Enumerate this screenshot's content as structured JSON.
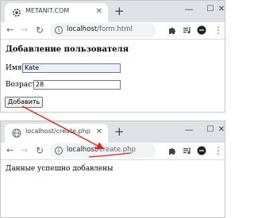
{
  "window1": {
    "tab_title": "METANIT.COM",
    "new_tab": "+",
    "url_host": "localhost",
    "url_path": "/form.html",
    "page": {
      "heading": "Добавление пользователя",
      "name_label": "Имя:",
      "name_value": "Kate",
      "age_label": "Возраст:",
      "age_value": "28",
      "submit_label": "Добавить"
    }
  },
  "window2": {
    "tab_title": "localhost/create.php",
    "new_tab": "+",
    "url_host": "localhost",
    "url_path": "/create.php",
    "page": {
      "message": "Данные успешно добавлены"
    }
  },
  "colors": {
    "annotation": "#e2231a",
    "tabstrip": "#dee1e6",
    "omnibox": "#f1f3f4",
    "autofill": "#e8f0fe"
  },
  "icons": {
    "favicon1": "gear-favicon",
    "favicon2": "globe-favicon",
    "back": "arrow-left",
    "forward": "arrow-right",
    "reload": "reload",
    "info": "info-circle",
    "extensions": "puzzle",
    "reading_list": "queue-music",
    "profile": "profile-avatar",
    "menu": "vertical-dots"
  }
}
